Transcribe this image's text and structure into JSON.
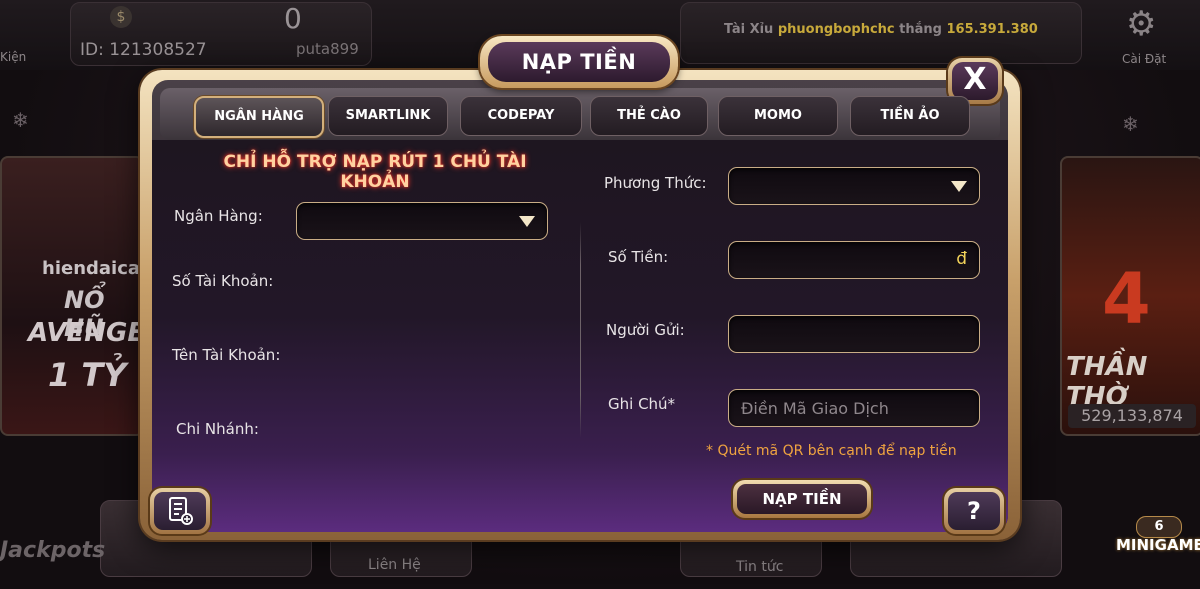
{
  "modal": {
    "title": "NẠP TIỀN",
    "close_label": "X",
    "tabs": [
      {
        "label": "NGÂN HÀNG"
      },
      {
        "label": "SMARTLINK"
      },
      {
        "label": "CODEPAY"
      },
      {
        "label": "THẺ CÀO"
      },
      {
        "label": "MOMO"
      },
      {
        "label": "TIỀN ẢO"
      }
    ],
    "notice": "CHỈ HỖ TRỢ NẠP RÚT 1 CHỦ TÀI KHOẢN",
    "left": {
      "bank_label": "Ngân Hàng:",
      "account_no_label": "Số Tài Khoản:",
      "account_name_label": "Tên Tài Khoản:",
      "branch_label": "Chi Nhánh:"
    },
    "right": {
      "method_label": "Phương Thức:",
      "amount_label": "Số Tiền:",
      "amount_currency": "đ",
      "sender_label": "Người Gửi:",
      "note_label": "Ghi Chú*",
      "note_placeholder": "Điền Mã Giao Dịch"
    },
    "qr_note": "* Quét mã QR bên cạnh để nạp tiền",
    "submit_label": "NẠP TIỀN",
    "help_label": "?"
  },
  "background": {
    "user_id": "ID: 121308527",
    "balance": "0",
    "username_partial": "puta899",
    "ticker_prefix": "Tài Xỉu",
    "ticker_user": "phuongbophchc",
    "ticker_verb": "thắng",
    "ticker_amount": "165.391.380",
    "settings_label": "Cài Đặt",
    "left_top_label": "Kiện",
    "left_card": {
      "line1": "hiendaica",
      "line2": "NỔ HŨ",
      "line3": "AVENGER",
      "line4": "1 TỶ"
    },
    "right_card": {
      "line1": "THẦN THỜ",
      "jackpot": "529,133,874"
    },
    "bottom_contact": "Liên Hệ",
    "bottom_news": "Tin tức",
    "jackpots_label": "Jackpots",
    "minigame_label": "MINIGAME",
    "minigame_count": "6"
  },
  "colors": {
    "gold_border": "#c9ad86",
    "notice_glow": "#ff3b2f",
    "qr_note": "#f0a440",
    "currency": "#f2d35a",
    "ticker_user": "#c7a93b",
    "ticker_amount": "#c7a93b"
  },
  "icons": {
    "close": "close-icon",
    "dropdown": "chevron-down-icon",
    "history": "receipt-icon",
    "help": "question-icon",
    "settings": "gear-icon"
  }
}
